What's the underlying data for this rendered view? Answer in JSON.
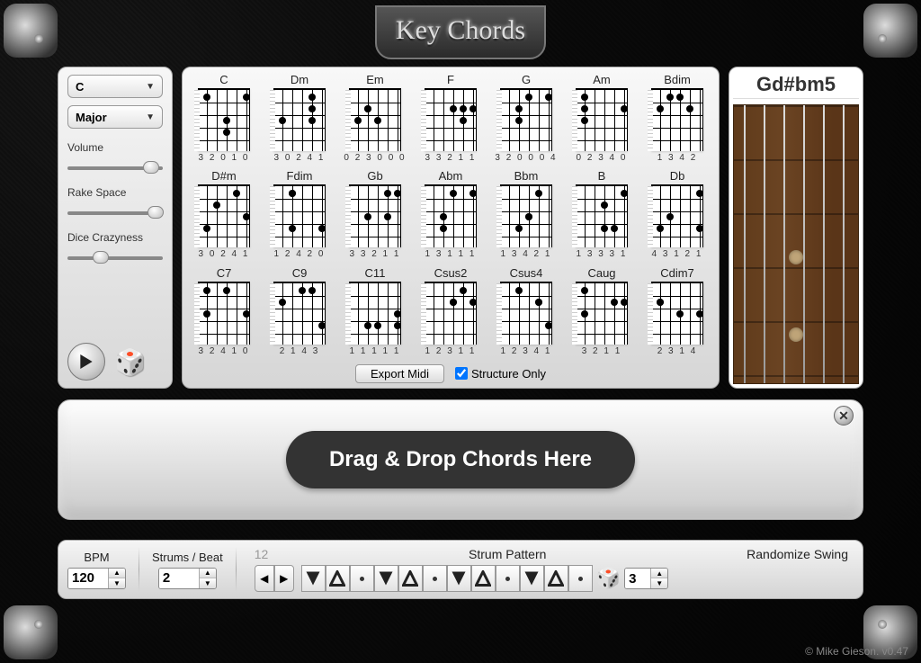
{
  "app": {
    "title": "Key Chords"
  },
  "controls": {
    "key": "C",
    "mode": "Major",
    "volume_label": "Volume",
    "volume_pct": 88,
    "rake_label": "Rake Space",
    "rake_pct": 92,
    "dice_label": "Dice Crazyness",
    "dice_pct": 35
  },
  "chords": [
    {
      "name": "C",
      "fingering": "3 2 0 1 0"
    },
    {
      "name": "Dm",
      "fingering": "3 0 2 4 1"
    },
    {
      "name": "Em",
      "fingering": "0 2 3 0 0 0"
    },
    {
      "name": "F",
      "fingering": "3 3 2 1 1"
    },
    {
      "name": "G",
      "fingering": "3 2 0 0 0 4"
    },
    {
      "name": "Am",
      "fingering": "0 2 3 4 0"
    },
    {
      "name": "Bdim",
      "fingering": "1 3 4 2"
    },
    {
      "name": "D#m",
      "fingering": "3 0 2 4 1"
    },
    {
      "name": "Fdim",
      "fingering": "1 2 4 2 0"
    },
    {
      "name": "Gb",
      "fingering": "3 3 2 1 1"
    },
    {
      "name": "Abm",
      "fingering": "1 3 1 1 1"
    },
    {
      "name": "Bbm",
      "fingering": "1 3 4 2 1"
    },
    {
      "name": "B",
      "fingering": "1 3 3 3 1"
    },
    {
      "name": "Db",
      "fingering": "4 3 1 2 1"
    },
    {
      "name": "C7",
      "fingering": "3 2 4 1 0"
    },
    {
      "name": "C9",
      "fingering": "2 1 4 3"
    },
    {
      "name": "C11",
      "fingering": "1 1 1 1 1"
    },
    {
      "name": "Csus2",
      "fingering": "1 2 3 1 1"
    },
    {
      "name": "Csus4",
      "fingering": "1 2 3 4 1"
    },
    {
      "name": "Caug",
      "fingering": "3 2 1 1"
    },
    {
      "name": "Cdim7",
      "fingering": "2 3 1 4"
    }
  ],
  "export": {
    "button": "Export Midi",
    "structure_only": "Structure Only",
    "structure_checked": true
  },
  "fretboard": {
    "label": "Gd#bm5"
  },
  "dropzone": {
    "hint": "Drag & Drop Chords Here"
  },
  "bottom": {
    "bpm_label": "BPM",
    "bpm": "120",
    "strums_label": "Strums / Beat",
    "strums": "2",
    "pattern_num": "12",
    "pattern_label": "Strum Pattern",
    "randomize_label": "Randomize Swing",
    "swing": "3",
    "pattern": [
      "down",
      "up",
      "dot",
      "down",
      "up",
      "dot",
      "down",
      "up",
      "dot",
      "down",
      "up",
      "dot"
    ]
  },
  "credit": "© Mike Gieson. v0.47"
}
